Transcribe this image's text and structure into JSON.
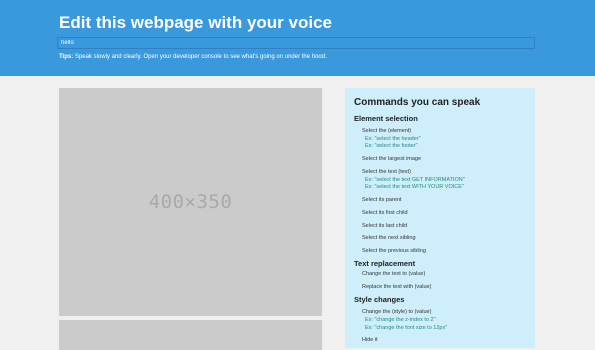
{
  "header": {
    "title": "Edit this webpage with your voice",
    "input_value": "hello",
    "tips_label": "Tips:",
    "tips_text": " Speak slowly and clearly. Open your developer console to see what's going on under the hood."
  },
  "placeholder": {
    "label": "400×350"
  },
  "commands": {
    "title": "Commands you can speak",
    "sections": [
      {
        "heading": "Element selection",
        "items": [
          {
            "command": "Select the (element)",
            "examples": [
              "Ex: \"select the header\"",
              "Ex: \"select the footer\""
            ]
          },
          {
            "command": "Select the largest image",
            "examples": []
          },
          {
            "command": "Select the text (text)",
            "examples": [
              "Ex: \"select the text GET INFORMATION\"",
              "Ex: \"select the text WITH YOUR VOICE\""
            ]
          },
          {
            "command": "Select its parent",
            "examples": []
          },
          {
            "command": "Select its first child",
            "examples": []
          },
          {
            "command": "Select its last child",
            "examples": []
          },
          {
            "command": "Select the next sibling",
            "examples": []
          },
          {
            "command": "Select the previous sibling",
            "examples": []
          }
        ]
      },
      {
        "heading": "Text replacement",
        "items": [
          {
            "command": "Change the text to (value)",
            "examples": []
          },
          {
            "command": "Replace the text with (value)",
            "examples": []
          }
        ]
      },
      {
        "heading": "Style changes",
        "items": [
          {
            "command": "Change the (style) to (value)",
            "examples": [
              "Ex: \"change the z-index to 2\"",
              "Ex: \"change the font size to 12px\""
            ]
          },
          {
            "command": "Hide it",
            "examples": []
          }
        ]
      }
    ]
  },
  "colors": {
    "header_bg": "#3a98dc",
    "panel_bg": "#cfeefb",
    "example_text": "#1f8a86",
    "placeholder_bg": "#cbcbcb"
  }
}
